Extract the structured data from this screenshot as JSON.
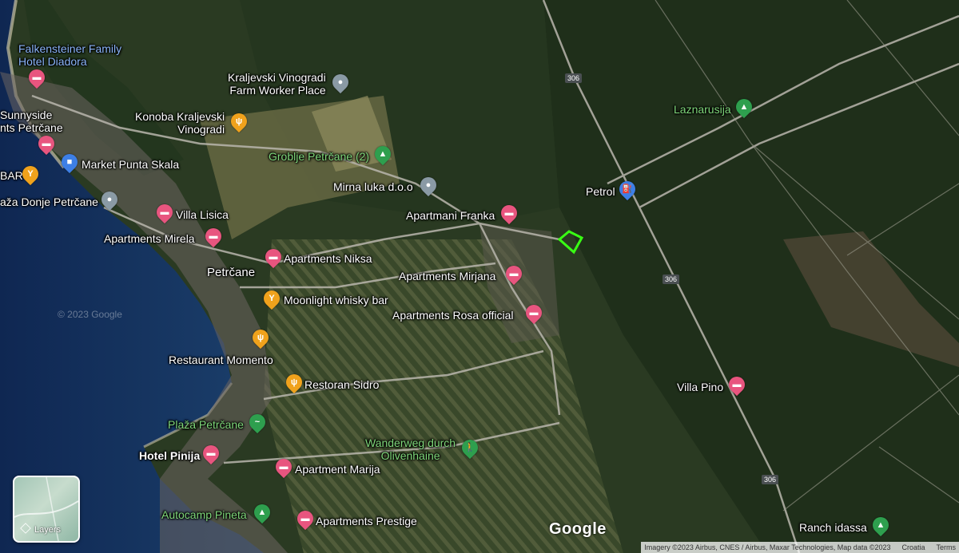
{
  "colors": {
    "sea": "#14305e",
    "sea_light": "#2a5f88",
    "forest": "#22331b",
    "field": "#6a6b45",
    "road": "#b9b6ad",
    "hotel": "#e8557f",
    "food": "#f0a21c",
    "park": "#2e9f4e",
    "grey": "#8a9aa5",
    "shop": "#3d7fe6",
    "boundary": "#39ff14"
  },
  "places": [
    {
      "label": "Falkensteiner Family\nHotel Diadora",
      "style": "blue",
      "icon": "none"
    },
    {
      "label": "Sunnyside\nnts Petrčane",
      "style": "white",
      "icon": "hotel-icon"
    },
    {
      "label": "Kraljevski Vinogradi\nFarm Worker Place",
      "style": "white",
      "icon": "place-icon"
    },
    {
      "label": "Konoba Kraljevski\nVinogradi",
      "style": "white",
      "icon": "restaurant-icon"
    },
    {
      "label": "BAR",
      "style": "white",
      "icon": "bar-icon"
    },
    {
      "label": "Market Punta Skala",
      "style": "white",
      "icon": "shopping-icon"
    },
    {
      "label": "Groblje Petrčane (2)",
      "style": "green",
      "icon": "park-icon"
    },
    {
      "label": "Laznarusija",
      "style": "green",
      "icon": "park-icon"
    },
    {
      "label": "Mirna luka d.o.o",
      "style": "white",
      "icon": "place-icon"
    },
    {
      "label": "Petrol",
      "style": "white",
      "icon": "gas-station-icon"
    },
    {
      "label": "aža Donje Petrčane",
      "style": "white",
      "icon": "place-icon"
    },
    {
      "label": "Villa Lisica",
      "style": "white",
      "icon": "hotel-icon"
    },
    {
      "label": "Apartmani Franka",
      "style": "white",
      "icon": "hotel-icon"
    },
    {
      "label": "Apartments Mirela",
      "style": "white",
      "icon": "hotel-icon"
    },
    {
      "label": "Apartments Niksa",
      "style": "white",
      "icon": "hotel-icon"
    },
    {
      "label": "Apartments Mirjana",
      "style": "white",
      "icon": "hotel-icon"
    },
    {
      "label": "Petrčane",
      "style": "white",
      "icon": "none"
    },
    {
      "label": "Moonlight whisky bar",
      "style": "white",
      "icon": "bar-icon"
    },
    {
      "label": "Apartments Rosa official",
      "style": "white",
      "icon": "hotel-icon"
    },
    {
      "label": "© 2023 Google",
      "style": "white",
      "icon": "none"
    },
    {
      "label": "Restaurant Momento",
      "style": "white",
      "icon": "restaurant-icon"
    },
    {
      "label": "Restoran Sidro",
      "style": "white",
      "icon": "restaurant-icon"
    },
    {
      "label": "Villa Pino",
      "style": "white",
      "icon": "hotel-icon"
    },
    {
      "label": "Plaža Petrčane",
      "style": "green",
      "icon": "beach-icon"
    },
    {
      "label": "Wanderweg durch\nOlivenhaine",
      "style": "green",
      "icon": "hiking-icon"
    },
    {
      "label": "Hotel Pinija",
      "style": "white",
      "icon": "hotel-icon"
    },
    {
      "label": "Apartment Marija",
      "style": "white",
      "icon": "hotel-icon"
    },
    {
      "label": "Autocamp Pineta",
      "style": "green",
      "icon": "campground-icon"
    },
    {
      "label": "Apartments Prestige",
      "style": "white",
      "icon": "hotel-icon"
    },
    {
      "label": "Ranch idassa",
      "style": "white",
      "icon": "park-icon"
    }
  ],
  "routes": [
    "306",
    "306",
    "306"
  ],
  "controls": {
    "layers": "Layers"
  },
  "branding": {
    "logo": "Google"
  },
  "attribution": [
    "Imagery ©2023 Airbus, CNES / Airbus, Maxar Technologies, Map data ©2023",
    "Croatia",
    "Terms"
  ]
}
